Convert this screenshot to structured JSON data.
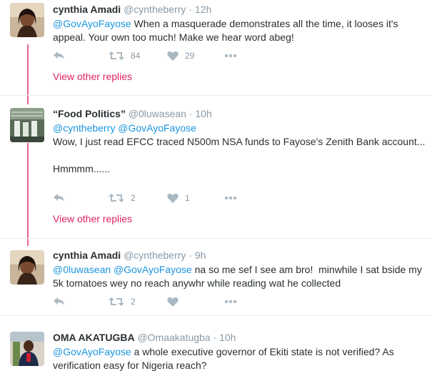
{
  "tweets": [
    {
      "name": "cynthia Amadi",
      "handle": "@cyntheberry",
      "dot": "·",
      "time": "12h",
      "mentions": "@GovAyoFayose",
      "text": " When a masquerade demonstrates all the time, it looses it's appeal. Your own too much! Make we hear word abeg!",
      "retweets": "84",
      "likes": "29"
    },
    {
      "name": "“Food Politics”",
      "handle": "@0luwasean",
      "dot": "·",
      "time": "10h",
      "mentions": "@cyntheberry @GovAyoFayose",
      "text": "Wow, I just read EFCC traced N500m NSA funds to Fayose's Zenith Bank account...\n\nHmmmm......",
      "retweets": "2",
      "likes": "1"
    },
    {
      "name": "cynthia Amadi",
      "handle": "@cyntheberry",
      "dot": "·",
      "time": "9h",
      "mentions": "@0luwasean @GovAyoFayose",
      "text": " na so me sef I see am bro!  minwhile I sat bside my 5k tomatoes wey no reach anywhr while reading wat he collected",
      "retweets": "2",
      "likes": ""
    },
    {
      "name": "OMA AKATUGBA",
      "handle": "@Omaakatugba",
      "dot": "·",
      "time": "10h",
      "mentions": "@GovAyoFayose",
      "text": " a whole executive governor of Ekiti state is not verified? As verification easy for Nigeria reach?"
    }
  ],
  "view_other_replies": "View other replies",
  "colors": {
    "accent_link": "#1b95e0",
    "thread": "#e0245e",
    "muted": "#8899a6"
  },
  "icons": [
    "reply-icon",
    "retweet-icon",
    "like-icon",
    "more-icon"
  ]
}
